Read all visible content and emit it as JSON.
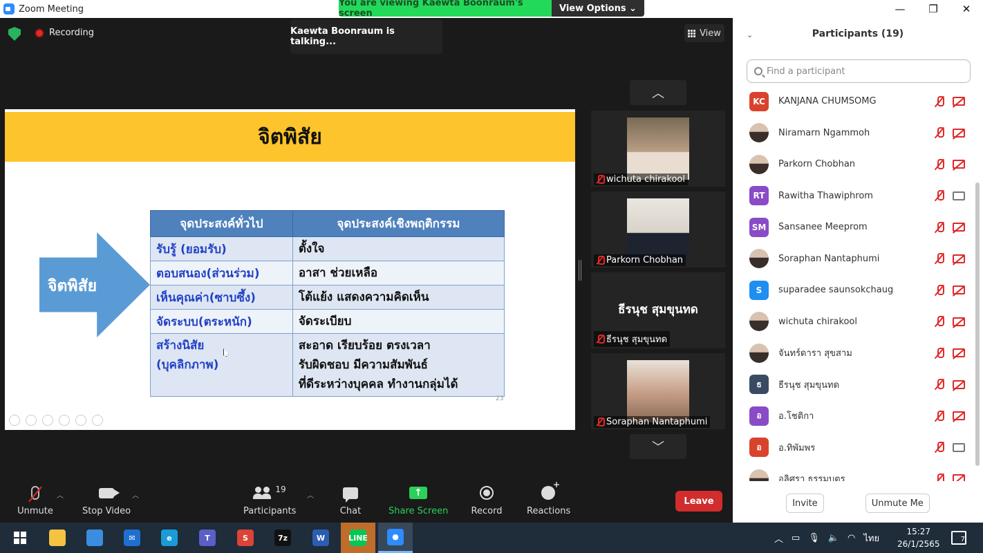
{
  "window": {
    "title": "Zoom Meeting",
    "share_banner": "You are viewing Kaewta Boonraum's screen",
    "view_options": "View Options ⌄",
    "minimize": "—",
    "maximize": "❐",
    "close": "✕"
  },
  "meeting": {
    "recording_label": "Recording",
    "talking": "Kaewta Boonraum is talking...",
    "view_label": "View"
  },
  "slide": {
    "title": "จิตพิสัย",
    "arrow_label": "จิตพิสัย",
    "table_headers": [
      "จุดประสงค์ทั่วไป",
      "จุดประสงค์เชิงพฤติกรรม"
    ],
    "rows": [
      {
        "left": "รับรู้ (ยอมรับ)",
        "right": "ตั้งใจ"
      },
      {
        "left": "ตอบสนอง(ส่วนร่วม)",
        "right": "อาสา ช่วยเหลือ"
      },
      {
        "left": "เห็นคุณค่า(ซาบซึ้ง)",
        "right": "โต้แย้ง แสดงความคิดเห็น"
      },
      {
        "left": "จัดระบบ(ตระหนัก)",
        "right": "จัดระเบียบ"
      },
      {
        "left": "สร้างนิสัย\n(บุคลิกภาพ)",
        "right": "สะอาด เรียบร้อย ตรงเวลา\nรับผิดชอบ มีความสัมพันธ์\nที่ดีระหว่างบุคคล ทำงานกลุ่มได้"
      }
    ],
    "page_number": "23"
  },
  "thumbnails": [
    {
      "name": "wichuta chirakool",
      "has_photo": true
    },
    {
      "name": "Parkorn Chobhan",
      "has_photo": true
    },
    {
      "name": "ธีรนุช สุมขุนทด",
      "big_name": "ธีรนุช สุมขุนทด",
      "has_photo": false
    },
    {
      "name": "Soraphan Nantaphumi",
      "has_photo": true
    }
  ],
  "toolbar": {
    "unmute": "Unmute",
    "stop_video": "Stop Video",
    "participants": "Participants",
    "participants_count": "19",
    "chat": "Chat",
    "share_screen": "Share Screen",
    "record": "Record",
    "reactions": "Reactions",
    "leave": "Leave"
  },
  "panel": {
    "title": "Participants (19)",
    "search_placeholder": "Find a participant",
    "invite": "Invite",
    "unmute_me": "Unmute Me",
    "participants": [
      {
        "initials": "KC",
        "color": "#d9432e",
        "name": "KANJANA CHUMSOMG",
        "photo": false,
        "video": false
      },
      {
        "initials": "",
        "color": "",
        "name": "Niramarn Ngammoh",
        "photo": true,
        "video": false
      },
      {
        "initials": "",
        "color": "",
        "name": "Parkorn Chobhan",
        "photo": true,
        "video": false
      },
      {
        "initials": "RT",
        "color": "#8a4bc6",
        "name": "Rawitha Thawiphrom",
        "photo": false,
        "video": true
      },
      {
        "initials": "SM",
        "color": "#8a4bc6",
        "name": "Sansanee Meeprom",
        "photo": false,
        "video": false
      },
      {
        "initials": "",
        "color": "",
        "name": "Soraphan Nantaphumi",
        "photo": true,
        "video": false
      },
      {
        "initials": "S",
        "color": "#1f8ef1",
        "name": "suparadee saunsokchaug",
        "photo": false,
        "video": false
      },
      {
        "initials": "",
        "color": "",
        "name": "wichuta chirakool",
        "photo": true,
        "video": false
      },
      {
        "initials": "",
        "color": "",
        "name": "จันทร์ดารา สุขสาม",
        "photo": true,
        "video": false
      },
      {
        "initials": "ธ",
        "color": "#3b4a63",
        "name": "ธีรนุช สุมขุนทด",
        "photo": false,
        "video": false
      },
      {
        "initials": "อ",
        "color": "#8a4bc6",
        "name": "อ.โชติกา",
        "photo": false,
        "video": false
      },
      {
        "initials": "อ",
        "color": "#d9432e",
        "name": "อ.ทิพัมพร",
        "photo": false,
        "video": true
      },
      {
        "initials": "",
        "color": "",
        "name": "อลิศรา ธรรมบุตร",
        "photo": true,
        "video": false
      }
    ]
  },
  "taskbar": {
    "apps": [
      {
        "name": "start-button",
        "glyph": "",
        "color": ""
      },
      {
        "name": "file-explorer-icon",
        "glyph": "",
        "color": "#f5c342"
      },
      {
        "name": "store-icon",
        "glyph": "",
        "color": "#3b8de0"
      },
      {
        "name": "mail-icon",
        "glyph": "✉",
        "color": "#1f6fd1"
      },
      {
        "name": "edge-icon",
        "glyph": "e",
        "color": "#1a9bd7"
      },
      {
        "name": "teams-icon",
        "glyph": "T",
        "color": "#5b5fc7"
      },
      {
        "name": "chrome-icon",
        "glyph": "S",
        "color": "#db4437"
      },
      {
        "name": "7zip-icon",
        "glyph": "7z",
        "color": "#111111"
      },
      {
        "name": "word-icon",
        "glyph": "W",
        "color": "#2b5eb3"
      },
      {
        "name": "line-icon",
        "glyph": "LINE",
        "color": "#06c755"
      },
      {
        "name": "zoom-icon",
        "glyph": "●",
        "color": "#2d8cff"
      }
    ],
    "lang": "ไทย",
    "time": "15:27",
    "date": "26/1/2565",
    "notifications": "7"
  }
}
